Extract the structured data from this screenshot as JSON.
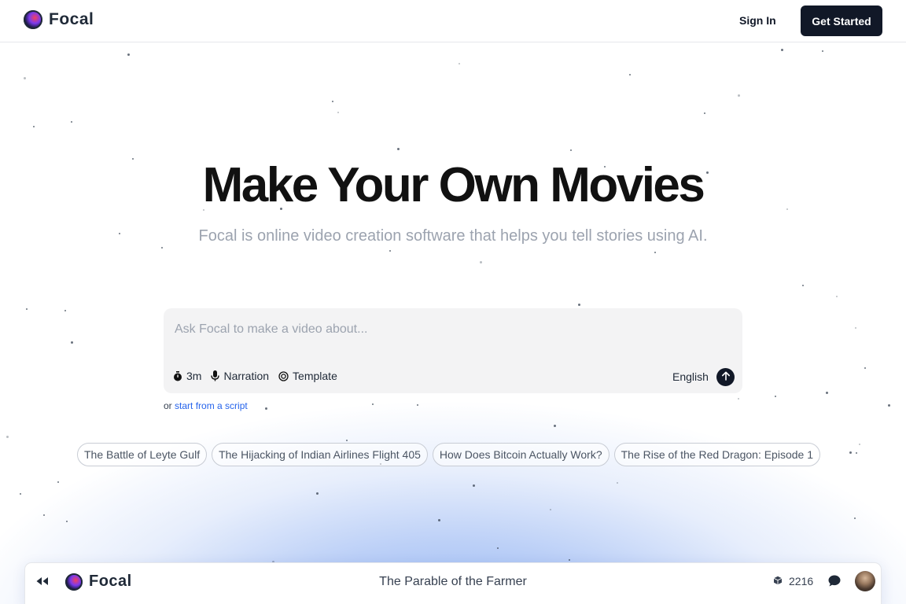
{
  "header": {
    "logo_text": "Focal",
    "signin_label": "Sign In",
    "get_started_label": "Get Started"
  },
  "hero": {
    "title": "Make Your Own Movies",
    "subtitle": "Focal is online video creation software that helps you tell stories using AI."
  },
  "prompt": {
    "placeholder": "Ask Focal to make a video about...",
    "duration_label": "3m",
    "narration_label": "Narration",
    "template_label": "Template",
    "language_label": "English",
    "script_prefix": "or",
    "script_link": "start from a script"
  },
  "chips": [
    "The Battle of Leyte Gulf",
    "The Hijacking of Indian Airlines Flight 405",
    "How Does Bitcoin Actually Work?",
    "The Rise of the Red Dragon: Episode 1"
  ],
  "player": {
    "logo_text": "Focal",
    "title": "The Parable of the Farmer",
    "count": "2216"
  },
  "icons": {
    "logo": "focal-logo-icon",
    "duration": "stopwatch-icon",
    "narration": "microphone-icon",
    "template": "target-icon",
    "send": "arrow-up-icon",
    "rewind": "rewind-icon",
    "count": "cube-icon",
    "comment": "comment-icon"
  },
  "colors": {
    "primary": "#111827",
    "link": "#2563eb",
    "glow": "#8fb3f3"
  }
}
